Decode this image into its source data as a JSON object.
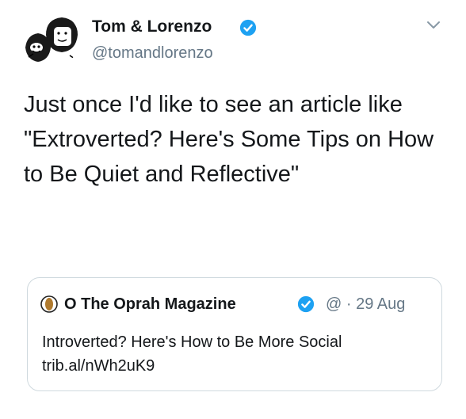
{
  "tweet": {
    "author": {
      "name": "Tom & Lorenzo",
      "handle": "@tomandlorenzo",
      "verified": true
    },
    "text": "Just once I'd like to see an article like \"Extroverted? Here's Some Tips on How to Be Quiet and Reflective\"",
    "quoted_tweet": {
      "author_name": "O The Oprah Magazine",
      "handle": "@",
      "separator": "·",
      "date": "29 Aug",
      "verified": true,
      "text": "Introverted? Here's How to Be More Social trib.al/nWh2uK9"
    }
  },
  "colors": {
    "verified": "#1da1f2",
    "secondary_text": "#657786",
    "primary_text": "#14171a",
    "border": "#cfd9de"
  }
}
